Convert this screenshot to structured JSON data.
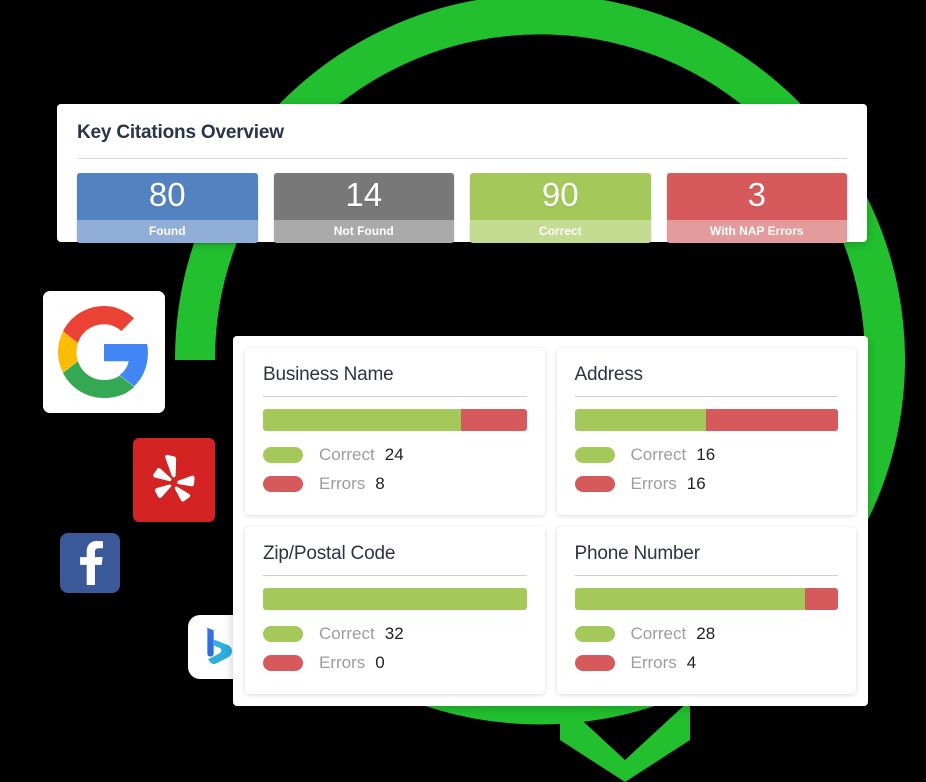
{
  "background_color": "#000000",
  "ring": {
    "name": "circular-arrow",
    "color": "#22c02e"
  },
  "logos": [
    {
      "name": "google-logo",
      "label": "Google",
      "tile_color": "#ffffff"
    },
    {
      "name": "yelp-logo",
      "label": "Yelp",
      "tile_color": "#d32323"
    },
    {
      "name": "facebook-logo",
      "label": "Facebook",
      "tile_color": "#3b5998"
    },
    {
      "name": "bing-logo",
      "label": "Bing",
      "tile_color": "#ffffff"
    }
  ],
  "overview": {
    "title": "Key Citations Overview",
    "stats": [
      {
        "value": "80",
        "label": "Found",
        "color": "#5382c0",
        "footer_color": "#90aed8"
      },
      {
        "value": "14",
        "label": "Not Found",
        "color": "#787878",
        "footer_color": "#aaaaaa"
      },
      {
        "value": "90",
        "label": "Correct",
        "color": "#a4c95a",
        "footer_color": "#c4dc92"
      },
      {
        "value": "3",
        "label": "With NAP Errors",
        "color": "#d6595b",
        "footer_color": "#e49b9c"
      }
    ]
  },
  "details": {
    "legend_correct_label": "Correct",
    "legend_errors_label": "Errors",
    "panels": [
      {
        "title": "Business Name",
        "correct": "24",
        "errors": "8",
        "correct_pct": "75%",
        "errors_pct": "25%"
      },
      {
        "title": "Address",
        "correct": "16",
        "errors": "16",
        "correct_pct": "50%",
        "errors_pct": "50%"
      },
      {
        "title": "Zip/Postal Code",
        "correct": "32",
        "errors": "0",
        "correct_pct": "100%",
        "errors_pct": "0%"
      },
      {
        "title": "Phone Number",
        "correct": "28",
        "errors": "4",
        "correct_pct": "87.5%",
        "errors_pct": "12.5%"
      }
    ]
  },
  "chart_data": {
    "type": "bar",
    "title": "Key Citations Overview",
    "summary": {
      "categories": [
        "Found",
        "Not Found",
        "Correct",
        "With NAP Errors"
      ],
      "values": [
        80,
        14,
        90,
        3
      ]
    },
    "categories": [
      "Business Name",
      "Address",
      "Zip/Postal Code",
      "Phone Number"
    ],
    "series": [
      {
        "name": "Correct",
        "values": [
          24,
          16,
          32,
          28
        ],
        "color": "#a4c95a"
      },
      {
        "name": "Errors",
        "values": [
          8,
          16,
          0,
          4
        ],
        "color": "#d6595b"
      }
    ],
    "stacked": true,
    "xlabel": "",
    "ylabel": "",
    "grid": false,
    "legend": "below-bar"
  }
}
